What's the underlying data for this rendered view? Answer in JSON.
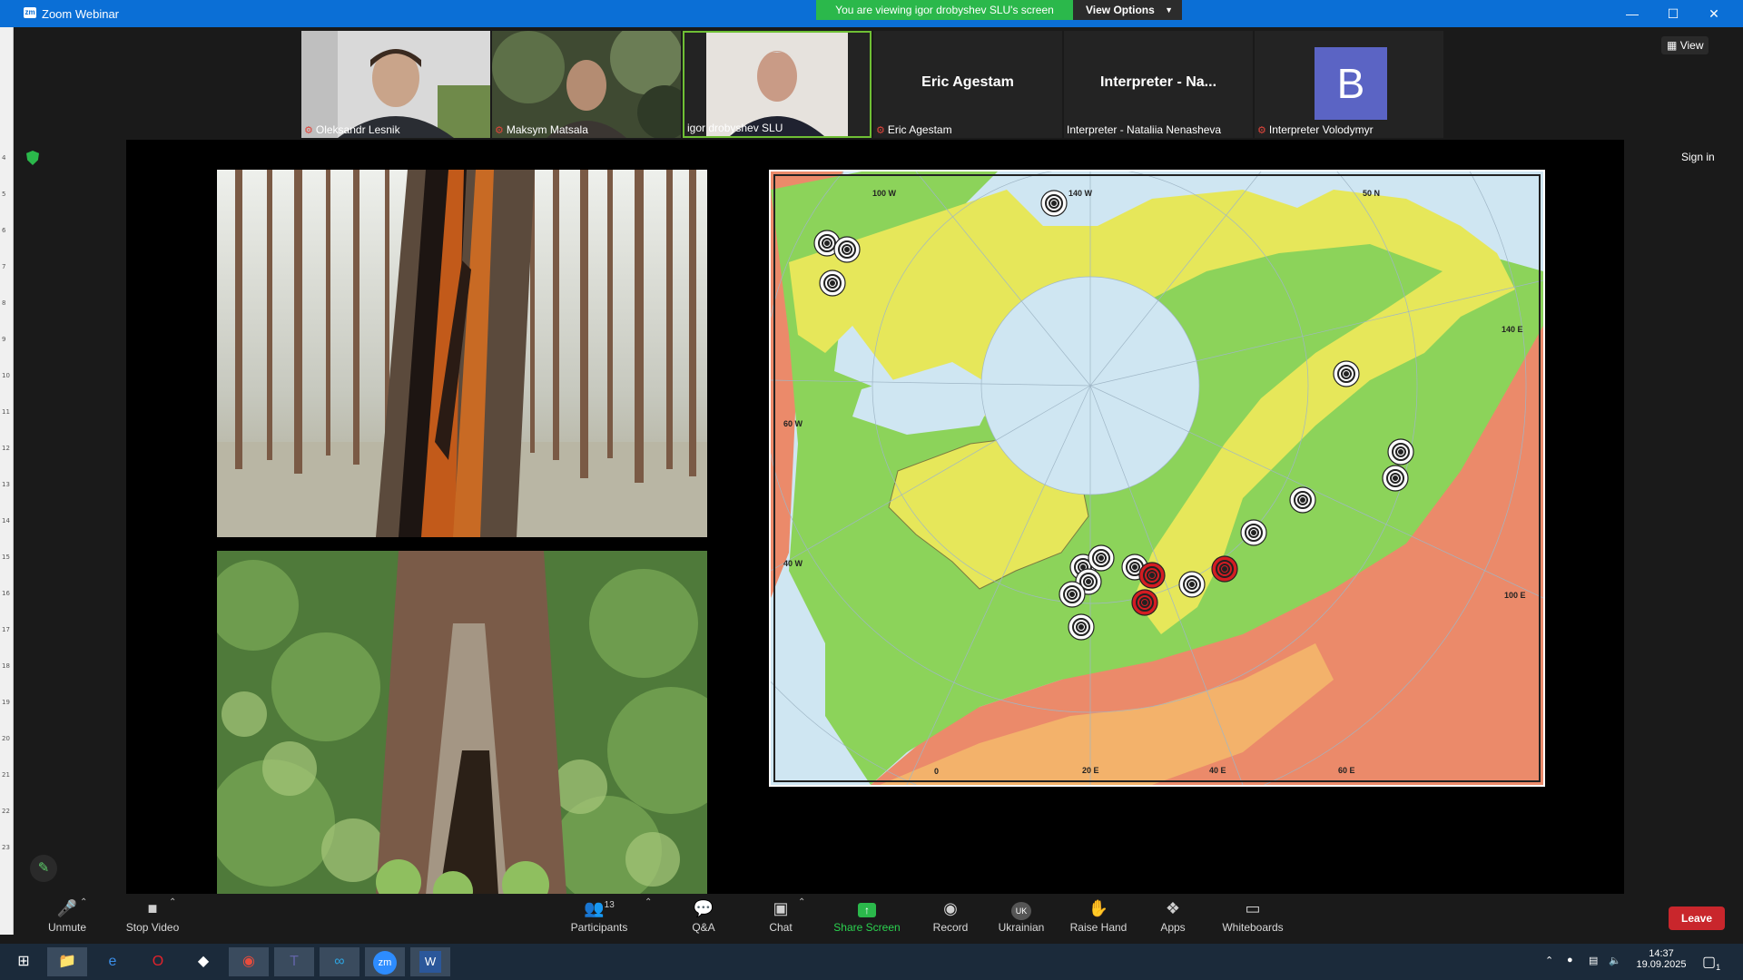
{
  "window": {
    "icon_text": "zm",
    "title": "Zoom Webinar",
    "share_banner": "You are viewing igor drobyshev SLU's screen",
    "view_options": "View Options",
    "controls": [
      "—",
      "☐",
      "✕"
    ]
  },
  "gallery": {
    "participants": [
      {
        "name": "Oleksandr Lesnik",
        "muted": true,
        "video": true
      },
      {
        "name": "Maksym Matsala",
        "muted": true,
        "video": true
      },
      {
        "name": "igor drobyshev SLU",
        "muted": false,
        "video": true,
        "active": true
      },
      {
        "name": "Eric Agestam",
        "muted": true,
        "video": false,
        "display": "Eric Agestam"
      },
      {
        "name": "Interpreter - Nataliia Nenasheva",
        "muted": false,
        "video": false,
        "display": "Interpreter - Na..."
      },
      {
        "name": "Interpreter Volodymyr",
        "muted": true,
        "video": false,
        "avatar_letter": "B"
      }
    ],
    "view_label": "View"
  },
  "side": {
    "sign_in": "Sign in"
  },
  "ruler_numbers": [
    "4",
    "5",
    "6",
    "7",
    "8",
    "9",
    "10",
    "11",
    "12",
    "13",
    "14",
    "15",
    "16",
    "17",
    "18",
    "19",
    "20",
    "21",
    "22",
    "23"
  ],
  "map": {
    "labels": {
      "lon_100w": "100 W",
      "lon_140w": "140 W",
      "lat_50n": "50 N",
      "lon_140e": "140 E",
      "lat_60w": "60 W",
      "lon_40w": "40 W",
      "lon_100e": "100 E",
      "lon_0": "0",
      "lon_20e": "20 E",
      "lon_40e": "40 E",
      "lon_60e": "60 E"
    },
    "colors": {
      "ocean": "#cfe6f2",
      "tundra": "#e6e75a",
      "boreal": "#8cd35a",
      "temperate": "#eb8a6a",
      "steppe": "#f3b26b",
      "site_white": "#ffffff",
      "site_red": "#d41c22"
    },
    "site_count_white": 19,
    "site_count_red": 3
  },
  "toolbar": {
    "unmute": "Unmute",
    "stop_video": "Stop Video",
    "participants": "Participants",
    "participants_count": "13",
    "qa": "Q&A",
    "chat": "Chat",
    "share_screen": "Share Screen",
    "record": "Record",
    "language": "Ukrainian",
    "language_code": "UK",
    "raise_hand": "Raise Hand",
    "apps": "Apps",
    "whiteboards": "Whiteboards",
    "leave": "Leave"
  },
  "taskbar": {
    "time": "14:37",
    "date": "19.09.2025",
    "notifications": "1"
  }
}
